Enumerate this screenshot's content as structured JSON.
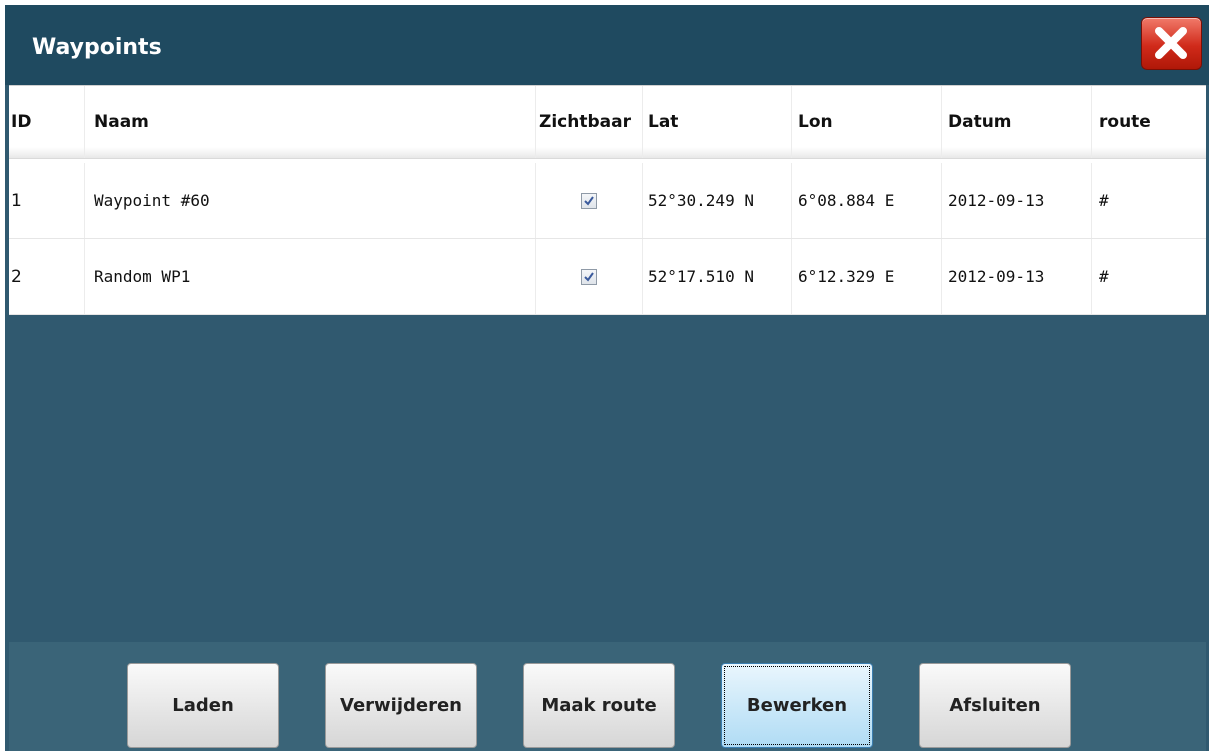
{
  "window": {
    "title": "Waypoints"
  },
  "table": {
    "columns": [
      "ID",
      "Naam",
      "Zichtbaar",
      "Lat",
      "Lon",
      "Datum",
      "route"
    ],
    "rows": [
      {
        "id": "1",
        "naam": "Waypoint #60",
        "zichtbaar": true,
        "lat": "52°30.249 N",
        "lon": "6°08.884 E",
        "datum": "2012-09-13",
        "route": "#"
      },
      {
        "id": "2",
        "naam": "Random WP1",
        "zichtbaar": true,
        "lat": "52°17.510 N",
        "lon": "6°12.329 E",
        "datum": "2012-09-13",
        "route": "#"
      }
    ]
  },
  "buttons": {
    "laden": "Laden",
    "verwijderen": "Verwijderen",
    "maak_route": "Maak route",
    "bewerken": "Bewerken",
    "afsluiten": "Afsluiten"
  },
  "icons": {
    "close": "close-icon",
    "check": "checkmark-icon"
  },
  "colors": {
    "titlebar": "#1f4a60",
    "panel": "#30596f",
    "close_button": "#d02a1a"
  }
}
